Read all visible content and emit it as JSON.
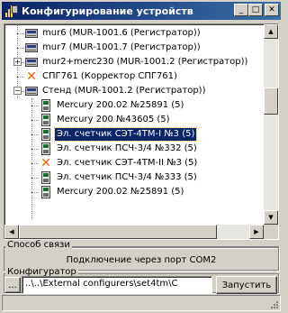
{
  "window": {
    "title": "Конфигурирование устройств",
    "buttons": {
      "minimize": "_",
      "maximize": "□",
      "close": "✕"
    }
  },
  "tree": {
    "items": [
      {
        "label": "mur6 (MUR-1001.6 (Регистратор))",
        "icon": "device-icon",
        "level": 1,
        "expander": "",
        "selected": false
      },
      {
        "label": "mur7 (MUR-1001.7 (Регистратор))",
        "icon": "device-icon",
        "level": 1,
        "expander": "",
        "selected": false
      },
      {
        "label": "mur2+merc230 (MUR-1001.2 (Регистратор))",
        "icon": "device-icon",
        "level": 1,
        "expander": "+",
        "selected": false
      },
      {
        "label": "СПГ761 (Корректор СПГ761)",
        "icon": "error-icon",
        "level": 1,
        "expander": "",
        "selected": false
      },
      {
        "label": "Стенд (MUR-1001.2 (Регистратор))",
        "icon": "device-icon",
        "level": 1,
        "expander": "−",
        "selected": false
      },
      {
        "label": "Mercury 200.02 №25891 (5)",
        "icon": "meter-icon",
        "level": 2,
        "expander": "",
        "selected": false
      },
      {
        "label": "Mercury 200 №43605 (5)",
        "icon": "meter-icon",
        "level": 2,
        "expander": "",
        "selected": false
      },
      {
        "label": "Эл. счетчик СЭТ-4ТМ-I №3 (5)",
        "icon": "meter-icon",
        "level": 2,
        "expander": "",
        "selected": true
      },
      {
        "label": "Эл. счетчик ПСЧ-3/4 №332 (5)",
        "icon": "meter-icon",
        "level": 2,
        "expander": "",
        "selected": false
      },
      {
        "label": "Эл. счетчик СЭТ-4ТМ-II №3 (5)",
        "icon": "error-icon",
        "level": 2,
        "expander": "",
        "selected": false
      },
      {
        "label": "Эл. счетчик ПСЧ-3/4 №333 (5)",
        "icon": "meter-icon",
        "level": 2,
        "expander": "",
        "selected": false
      },
      {
        "label": "Mercury 200.02 №25891 (5)",
        "icon": "meter-icon",
        "level": 2,
        "expander": "",
        "selected": false
      }
    ]
  },
  "connection": {
    "caption": "Способ связи",
    "text": "Подключение через порт COM2"
  },
  "configurator": {
    "caption": "Конфигуратор",
    "browse_label": "...",
    "path_value": "..\\..\\External configurers\\set4tm\\C",
    "run_label": "Запустить"
  }
}
